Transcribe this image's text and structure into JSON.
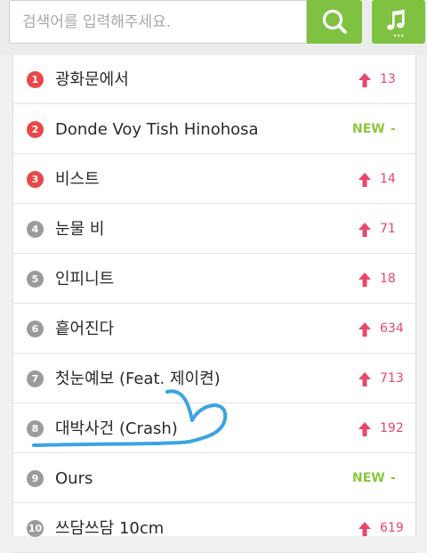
{
  "search": {
    "placeholder": "검색어를 입력해주세요.",
    "value": ""
  },
  "icons": {
    "search": "search-icon",
    "music": "music-note-icon",
    "rise": "up-arrow-icon"
  },
  "colors": {
    "accent": "#7fc242",
    "top_rank": "#e94848",
    "rise": "#e8476b",
    "new": "#8cc63f"
  },
  "chart": {
    "items": [
      {
        "rank": "1",
        "title": "광화문에서",
        "status": "up",
        "change": "13"
      },
      {
        "rank": "2",
        "title": "Donde Voy Tish Hinohosa",
        "status": "new",
        "change": "-"
      },
      {
        "rank": "3",
        "title": "비스트",
        "status": "up",
        "change": "14"
      },
      {
        "rank": "4",
        "title": "눈물 비",
        "status": "up",
        "change": "71"
      },
      {
        "rank": "5",
        "title": "인피니트",
        "status": "up",
        "change": "18"
      },
      {
        "rank": "6",
        "title": "흩어진다",
        "status": "up",
        "change": "634"
      },
      {
        "rank": "7",
        "title": "첫눈예보 (Feat. 제이켠)",
        "status": "up",
        "change": "713"
      },
      {
        "rank": "8",
        "title": "대박사건 (Crash)",
        "status": "up",
        "change": "192"
      },
      {
        "rank": "9",
        "title": "Ours",
        "status": "new",
        "change": "-"
      },
      {
        "rank": "10",
        "title": "쓰담쓰담 10cm",
        "status": "up",
        "change": "619"
      }
    ],
    "new_label": "NEW"
  }
}
